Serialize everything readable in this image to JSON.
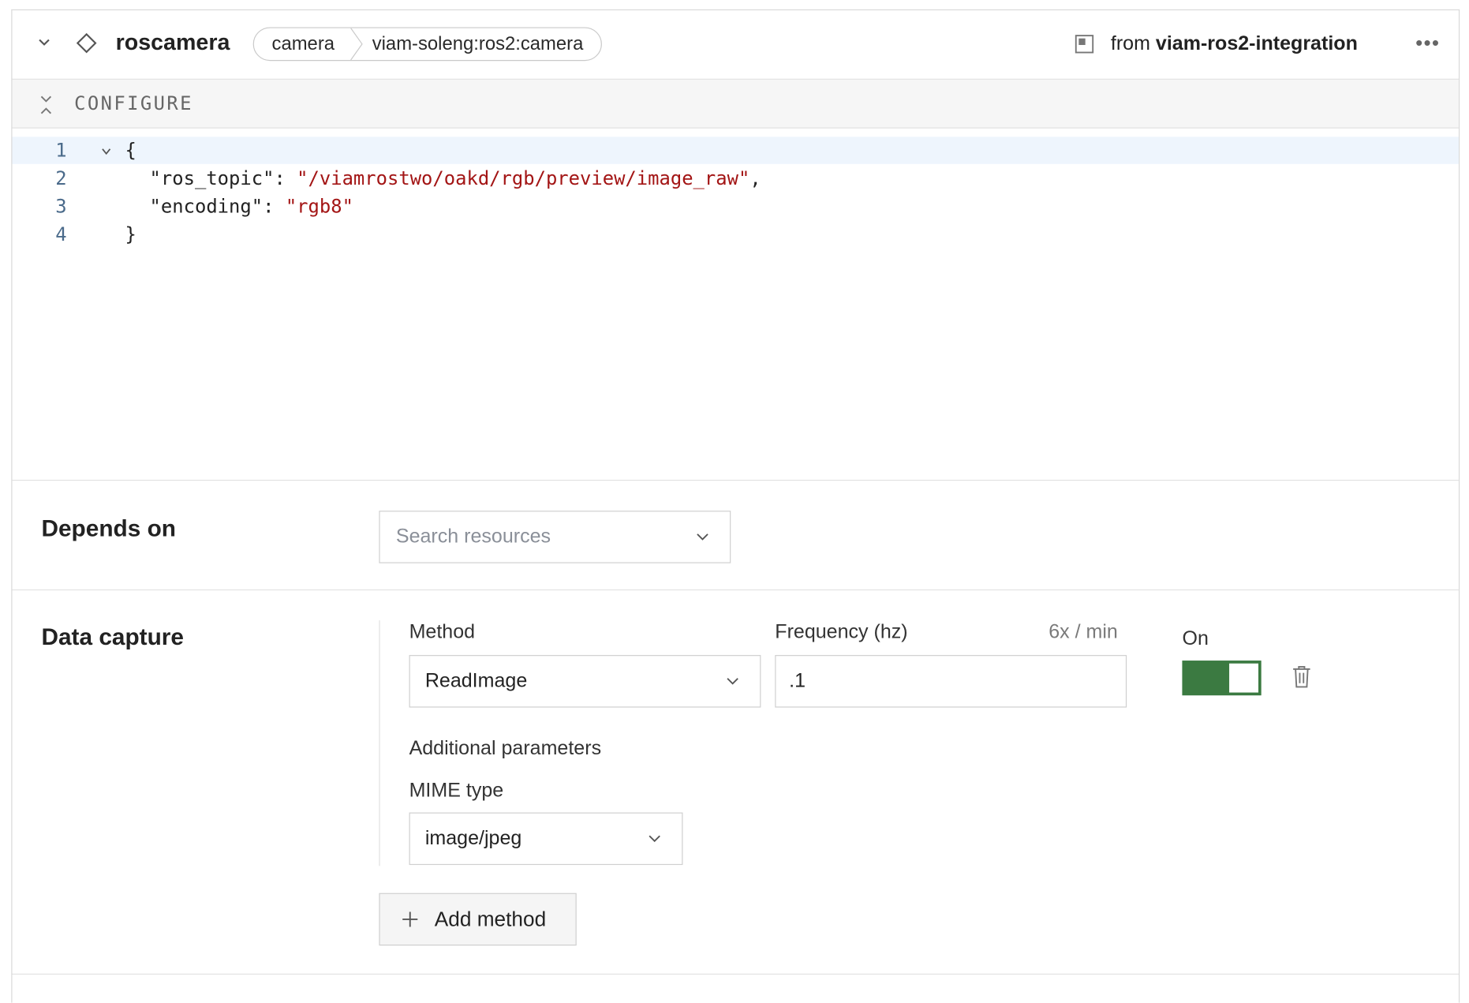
{
  "header": {
    "name": "roscamera",
    "type_label": "camera",
    "model_label": "viam-soleng:ros2:camera",
    "from_prefix": "from",
    "module_name": "viam-ros2-integration",
    "more_label": "•••"
  },
  "configure": {
    "label": "CONFIGURE"
  },
  "editor": {
    "line_numbers": [
      "1",
      "2",
      "3",
      "4"
    ],
    "lines": {
      "l1": "{",
      "l2_key": "\"ros_topic\"",
      "l2_colon": ": ",
      "l2_value": "\"/viamrostwo/oakd/rgb/preview/image_raw\"",
      "l2_comma": ",",
      "l3_key": "\"encoding\"",
      "l3_colon": ": ",
      "l3_value": "\"rgb8\"",
      "l4": "}"
    }
  },
  "depends_on": {
    "title": "Depends on",
    "search_placeholder": "Search resources"
  },
  "data_capture": {
    "title": "Data capture",
    "method_label": "Method",
    "method_value": "ReadImage",
    "frequency_label": "Frequency (hz)",
    "frequency_hint": "6x / min",
    "frequency_value": ".1",
    "on_label": "On",
    "toggle_on": true,
    "additional_parameters_label": "Additional parameters",
    "mime_label": "MIME type",
    "mime_value": "image/jpeg",
    "add_method_label": "Add method"
  },
  "colors": {
    "toggle_on": "#3b7a41",
    "string_literal": "#a31515",
    "line_number": "#4a6a8a",
    "active_line": "#eef5fd"
  }
}
